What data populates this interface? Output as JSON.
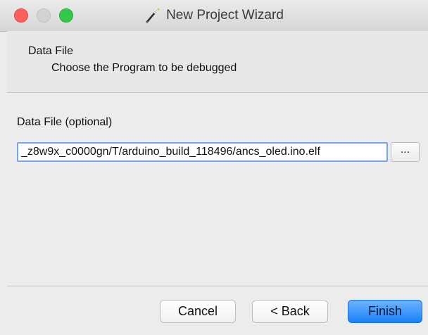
{
  "window": {
    "title": "New Project Wizard",
    "title_icon": "magic-wand-icon"
  },
  "header": {
    "title": "Data File",
    "description": "Choose the Program to be debugged"
  },
  "form": {
    "label": "Data File (optional)",
    "value": "_z8w9x_c0000gn/T/arduino_build_118496/ancs_oled.ino.elf",
    "browse_label": "..."
  },
  "buttons": {
    "cancel": "Cancel",
    "back": "< Back",
    "finish": "Finish"
  },
  "colors": {
    "accent": "#1a82fb",
    "focus_border": "#76a7e8",
    "close": "#fc605c",
    "maximize": "#34c84a"
  }
}
